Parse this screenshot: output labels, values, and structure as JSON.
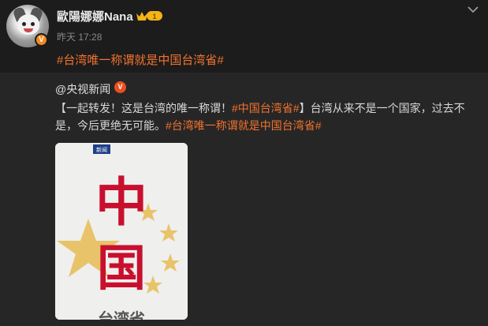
{
  "post": {
    "author": "歐陽娜娜Nana",
    "verified_badge": "V",
    "vip_level": "1",
    "time": "昨天 17:28",
    "text": "#台湾唯一称谓就是中国台湾省#"
  },
  "repost": {
    "author": "@央视新闻",
    "verified_badge": "V",
    "text_part1": "【一起转发！这是台湾的唯一称谓！",
    "tag1": "#中国台湾省#",
    "text_part2": "】台湾从来不是一个国家，过去不是，今后更绝无可能。",
    "tag2": "#台湾唯一称谓就是中国台湾省#",
    "image": {
      "corner_label": "新闻",
      "calligraphy": [
        "中",
        "国"
      ],
      "bottom_text": "台湾省"
    }
  },
  "colors": {
    "accent": "#f2722e",
    "background": "#1c1c1c",
    "repost_background": "#262626",
    "flag_red": "#c8102e",
    "star_gold": "#e8c36a"
  },
  "icons": [
    "chevron-down-icon",
    "vip-crown-icon",
    "verified-icon"
  ]
}
